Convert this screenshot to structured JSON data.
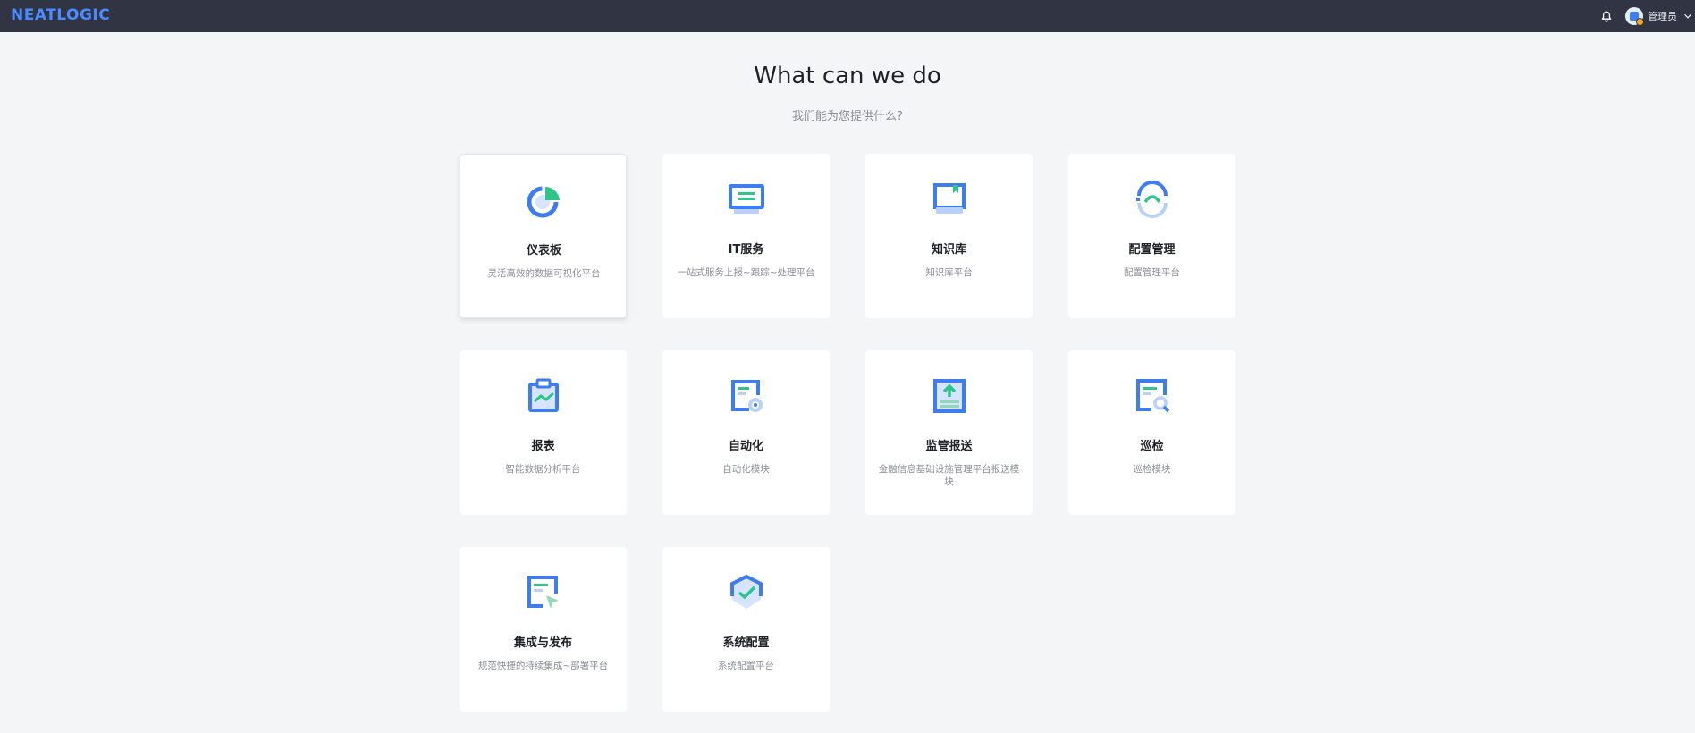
{
  "header": {
    "logo": "NEATLOGIC",
    "user_name": "管理员"
  },
  "hero": {
    "title": "What can we do",
    "subtitle": "我们能为您提供什么?"
  },
  "modules": [
    {
      "name": "仪表板",
      "desc": "灵活高效的数据可视化平台",
      "icon": "dashboard-icon"
    },
    {
      "name": "IT服务",
      "desc": "一站式服务上报~跟踪~处理平台",
      "icon": "it-service-icon"
    },
    {
      "name": "知识库",
      "desc": "知识库平台",
      "icon": "knowledge-base-icon"
    },
    {
      "name": "配置管理",
      "desc": "配置管理平台",
      "icon": "cmdb-icon"
    },
    {
      "name": "报表",
      "desc": "智能数据分析平台",
      "icon": "report-icon"
    },
    {
      "name": "自动化",
      "desc": "自动化模块",
      "icon": "automation-icon"
    },
    {
      "name": "监管报送",
      "desc": "金融信息基础设施管理平台报送模块",
      "icon": "regulatory-report-icon"
    },
    {
      "name": "巡检",
      "desc": "巡检模块",
      "icon": "inspection-icon"
    },
    {
      "name": "集成与发布",
      "desc": "规范快捷的持续集成~部署平台",
      "icon": "ci-cd-icon"
    },
    {
      "name": "系统配置",
      "desc": "系统配置平台",
      "icon": "system-config-icon"
    }
  ],
  "colors": {
    "topbar": "#313442",
    "brand_blue": "#3e7cf2",
    "accent_green": "#2fc58a",
    "light_blue": "#b8d0fb"
  }
}
